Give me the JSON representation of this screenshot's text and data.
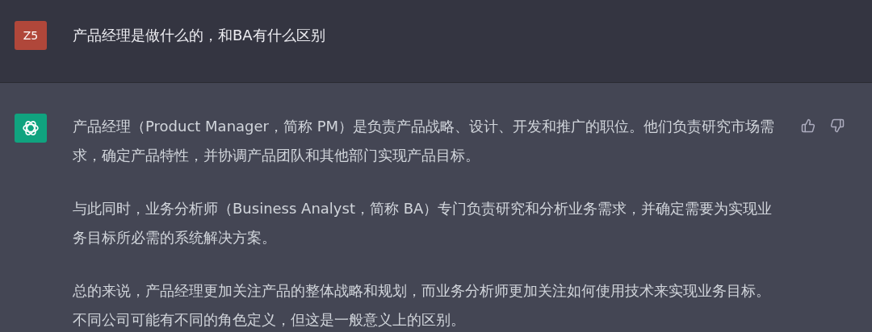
{
  "user_message": {
    "avatar": "Z5",
    "text": "产品经理是做什么的，和BA有什么区别"
  },
  "assistant_message": {
    "paragraphs": [
      "产品经理（Product Manager，简称 PM）是负责产品战略、设计、开发和推广的职位。他们负责研究市场需求，确定产品特性，并协调产品团队和其他部门实现产品目标。",
      "与此同时，业务分析师（Business Analyst，简称 BA）专门负责研究和分析业务需求，并确定需要为实现业务目标所必需的系统解决方案。",
      "总的来说，产品经理更加关注产品的整体战略和规划，而业务分析师更加关注如何使用技术来实现业务目标。不同公司可能有不同的角色定义，但这是一般意义上的区别。"
    ]
  }
}
